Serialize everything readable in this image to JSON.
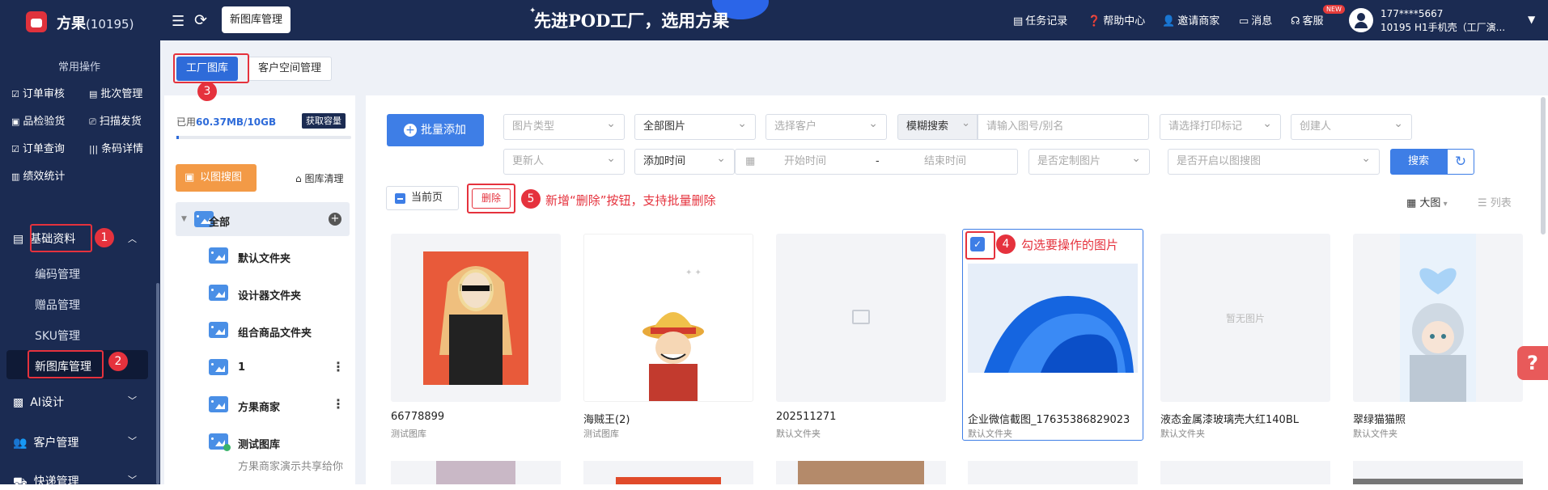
{
  "app": {
    "name": "方果",
    "id_suffix": "(10195)",
    "active_tab": "新图库管理",
    "slogan": "先进POD工厂，选用方果"
  },
  "topnav": {
    "tasks": "任务记录",
    "help": "帮助中心",
    "invite": "邀请商家",
    "messages": "消息",
    "service": "客服",
    "new_badge": "NEW",
    "user_phone": "177****5667",
    "user_name": "10195 H1手机壳（工厂演..."
  },
  "sidebar": {
    "common_title": "常用操作",
    "quick": [
      "订单审核",
      "批次管理",
      "品检验货",
      "扫描发货",
      "订单查询",
      "条码详情",
      "绩效统计"
    ],
    "basic": "基础资料",
    "basic_items": [
      "编码管理",
      "赠品管理",
      "SKU管理",
      "新图库管理"
    ],
    "ai": "AI设计",
    "customer": "客户管理",
    "express": "快递管理"
  },
  "tabs": {
    "factory": "工厂图库",
    "customer_space": "客户空间管理"
  },
  "storage": {
    "used_label": "已用",
    "used_value": "60.37MB/10GB",
    "get_capacity": "获取容量"
  },
  "left": {
    "image_search": "以图搜图",
    "clean": "图库清理",
    "folders": [
      {
        "name": "全部"
      },
      {
        "name": "默认文件夹"
      },
      {
        "name": "设计器文件夹"
      },
      {
        "name": "组合商品文件夹"
      },
      {
        "name": "1"
      },
      {
        "name": "方果商家"
      },
      {
        "name": "测试图库"
      }
    ],
    "share_note": "方果商家演示共享给你"
  },
  "toolbar": {
    "batch_add": "批量添加",
    "filters_row1": [
      "图片类型",
      "全部图片",
      "选择客户"
    ],
    "fuzzy": "模糊搜索",
    "search_placeholder": "请输入图号/别名",
    "print_mark": "请选择打印标记",
    "creator": "创建人",
    "updater": "更新人",
    "add_time": "添加时间",
    "start_time": "开始时间",
    "dash": "-",
    "end_time": "结束时间",
    "custom": "是否定制图片",
    "image_search_enabled": "是否开启以图搜图",
    "search": "搜索",
    "current_page": "当前页",
    "delete": "删除",
    "large": "大图",
    "list": "列表"
  },
  "annotations": {
    "n1": "1",
    "n2": "2",
    "n3": "3",
    "n4": "4",
    "n5": "5",
    "note4": "勾选要操作的图片",
    "note5": "新增“删除”按钮，支持批量删除"
  },
  "cards": [
    {
      "name": "66778899",
      "folder": "测试图库"
    },
    {
      "name": "海贼王(2)",
      "folder": "测试图库"
    },
    {
      "name": "202511271",
      "folder": "默认文件夹"
    },
    {
      "name": "企业微信截图_17635386829023",
      "folder": "默认文件夹"
    },
    {
      "name": "液态金属漆玻璃壳大红140BL",
      "folder": "默认文件夹",
      "placeholder": "暂无图片"
    },
    {
      "name": "翠绿猫猫照",
      "folder": "默认文件夹"
    }
  ]
}
